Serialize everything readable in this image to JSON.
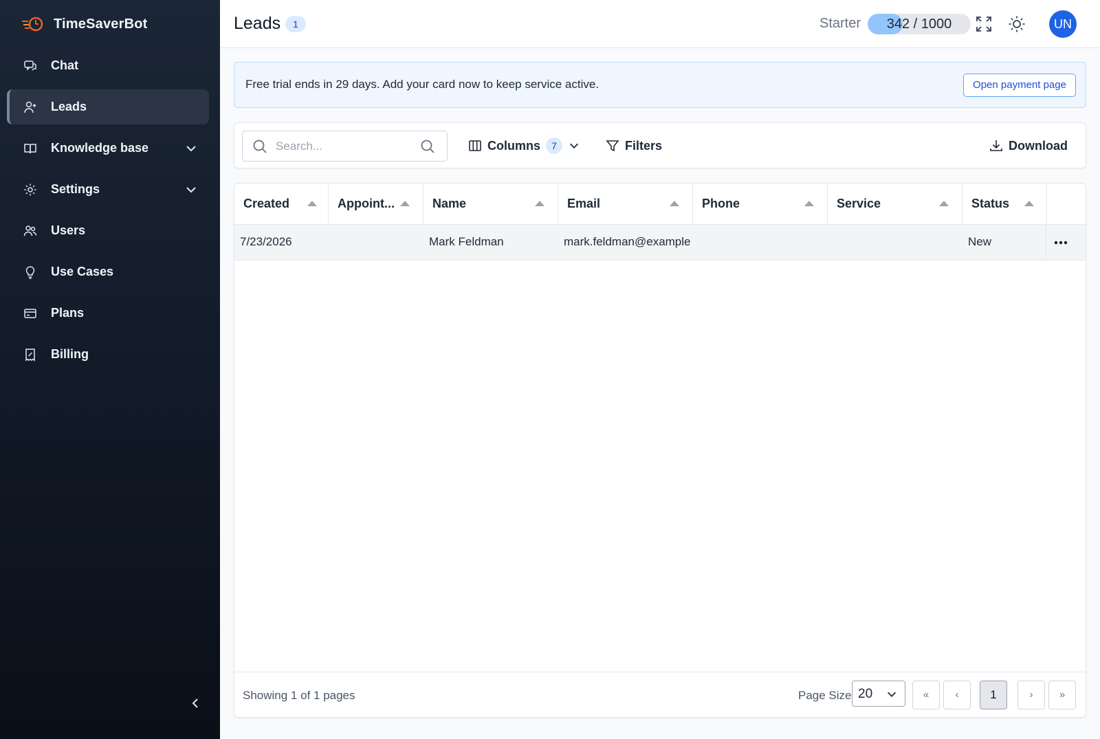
{
  "app": {
    "name": "TimeSaverBot"
  },
  "sidebar": {
    "items": [
      {
        "label": "Chat",
        "icon": "chat-icon",
        "active": false,
        "expandable": false
      },
      {
        "label": "Leads",
        "icon": "user-plus-icon",
        "active": true,
        "expandable": false
      },
      {
        "label": "Knowledge base",
        "icon": "book-icon",
        "active": false,
        "expandable": true
      },
      {
        "label": "Settings",
        "icon": "gear-icon",
        "active": false,
        "expandable": true
      },
      {
        "label": "Users",
        "icon": "users-icon",
        "active": false,
        "expandable": false
      },
      {
        "label": "Use Cases",
        "icon": "lightbulb-icon",
        "active": false,
        "expandable": false
      },
      {
        "label": "Plans",
        "icon": "credit-card-icon",
        "active": false,
        "expandable": false
      },
      {
        "label": "Billing",
        "icon": "receipt-icon",
        "active": false,
        "expandable": false
      }
    ]
  },
  "header": {
    "title": "Leads",
    "count": "1",
    "plan": "Starter",
    "usage": {
      "used": 342,
      "limit": 1000,
      "text": "342 / 1000"
    },
    "avatar_initials": "UN"
  },
  "banner": {
    "text": "Free trial ends in 29 days. Add your card now to keep service active.",
    "button": "Open payment page"
  },
  "toolbar": {
    "search_placeholder": "Search...",
    "columns_label": "Columns",
    "columns_count": "7",
    "filters_label": "Filters",
    "download_label": "Download"
  },
  "table": {
    "columns": [
      "Created",
      "Appoint...",
      "Name",
      "Email",
      "Phone",
      "Service",
      "Status"
    ],
    "rows": [
      {
        "created": "7/23/2026",
        "appointment": "",
        "name": "Mark Feldman",
        "email": "mark.feldman@example",
        "phone": "",
        "service": "",
        "status": "New"
      }
    ]
  },
  "footer": {
    "showing": "Showing 1 of 1 pages",
    "page_size_label": "Page Size",
    "page_size": "20",
    "first": "«",
    "prev": "‹",
    "current_page": "1",
    "next": "›",
    "last": "»"
  },
  "colors": {
    "sidebar_top": "#1b2636",
    "sidebar_bottom": "#0a0f18",
    "accent": "#1d63e4",
    "badge_bg": "#dbeafe",
    "usage_fill": "#93c5fd"
  }
}
